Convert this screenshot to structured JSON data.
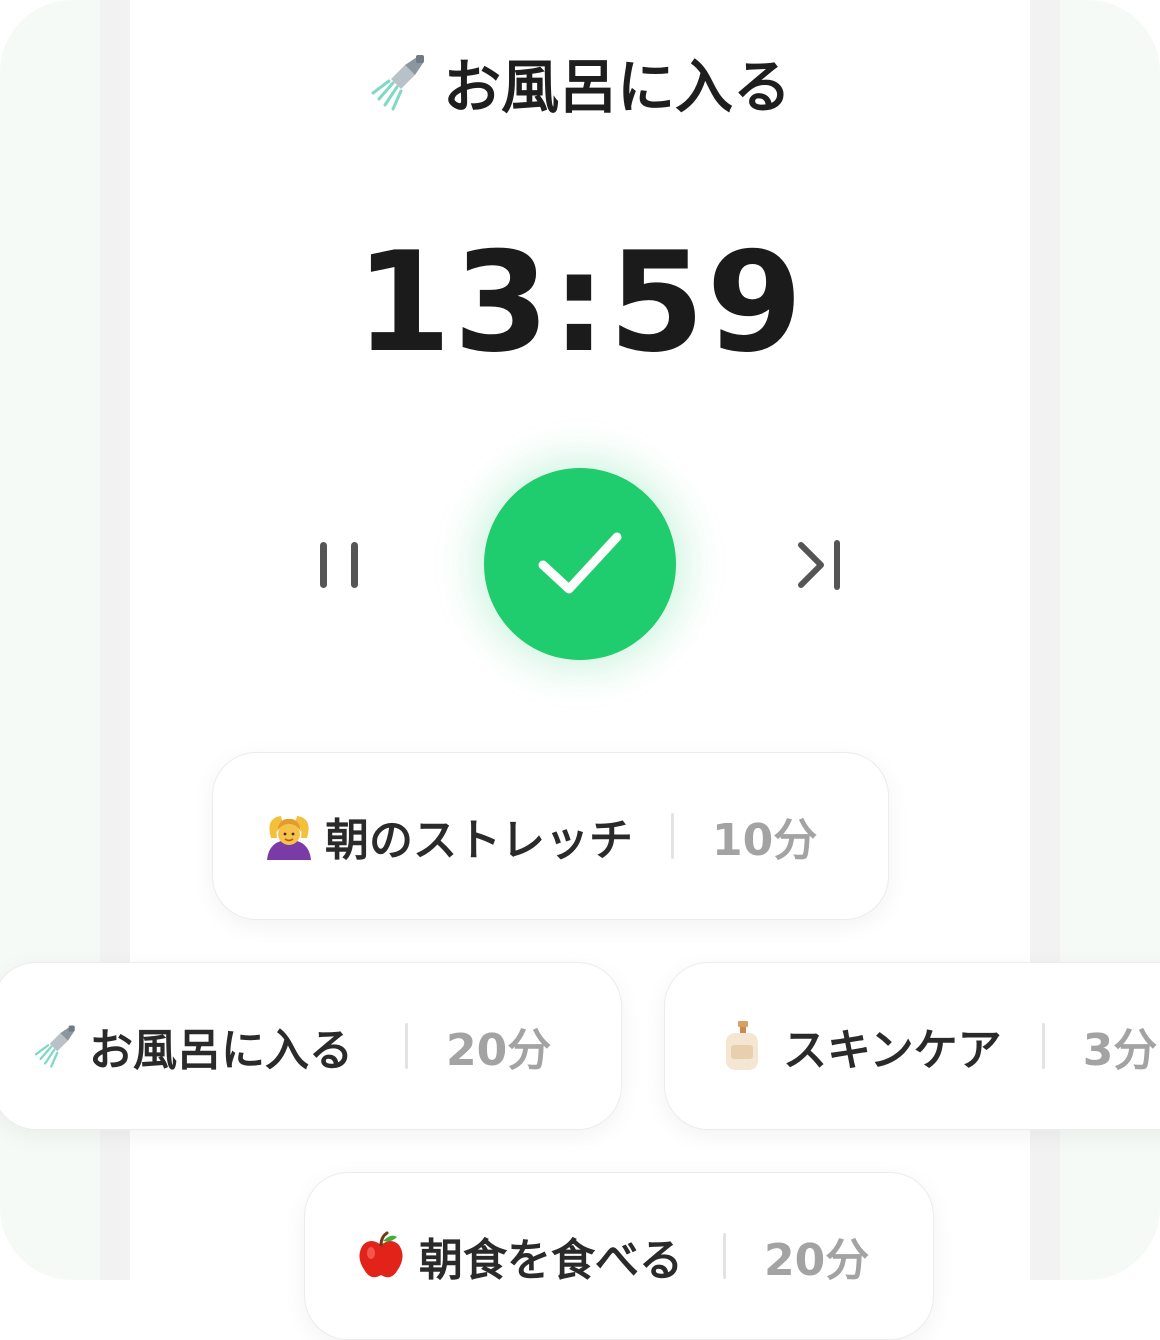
{
  "current_task": {
    "title": "お風呂に入る",
    "icon": "shower-icon",
    "timer": "13:59"
  },
  "controls": {
    "pause_icon": "pause-icon",
    "done_icon": "checkmark-icon",
    "skip_icon": "skip-next-icon",
    "accent_color": "#1fcc6e"
  },
  "tasks": [
    {
      "icon": "woman-gesturing-ok-icon",
      "name": "朝のストレッチ",
      "duration": "10分"
    },
    {
      "icon": "shower-icon",
      "name": "お風呂に入る",
      "duration": "20分"
    },
    {
      "icon": "lotion-bottle-icon",
      "name": "スキンケア",
      "duration": "3分"
    },
    {
      "icon": "red-apple-icon",
      "name": "朝食を食べる",
      "duration": "20分"
    }
  ]
}
